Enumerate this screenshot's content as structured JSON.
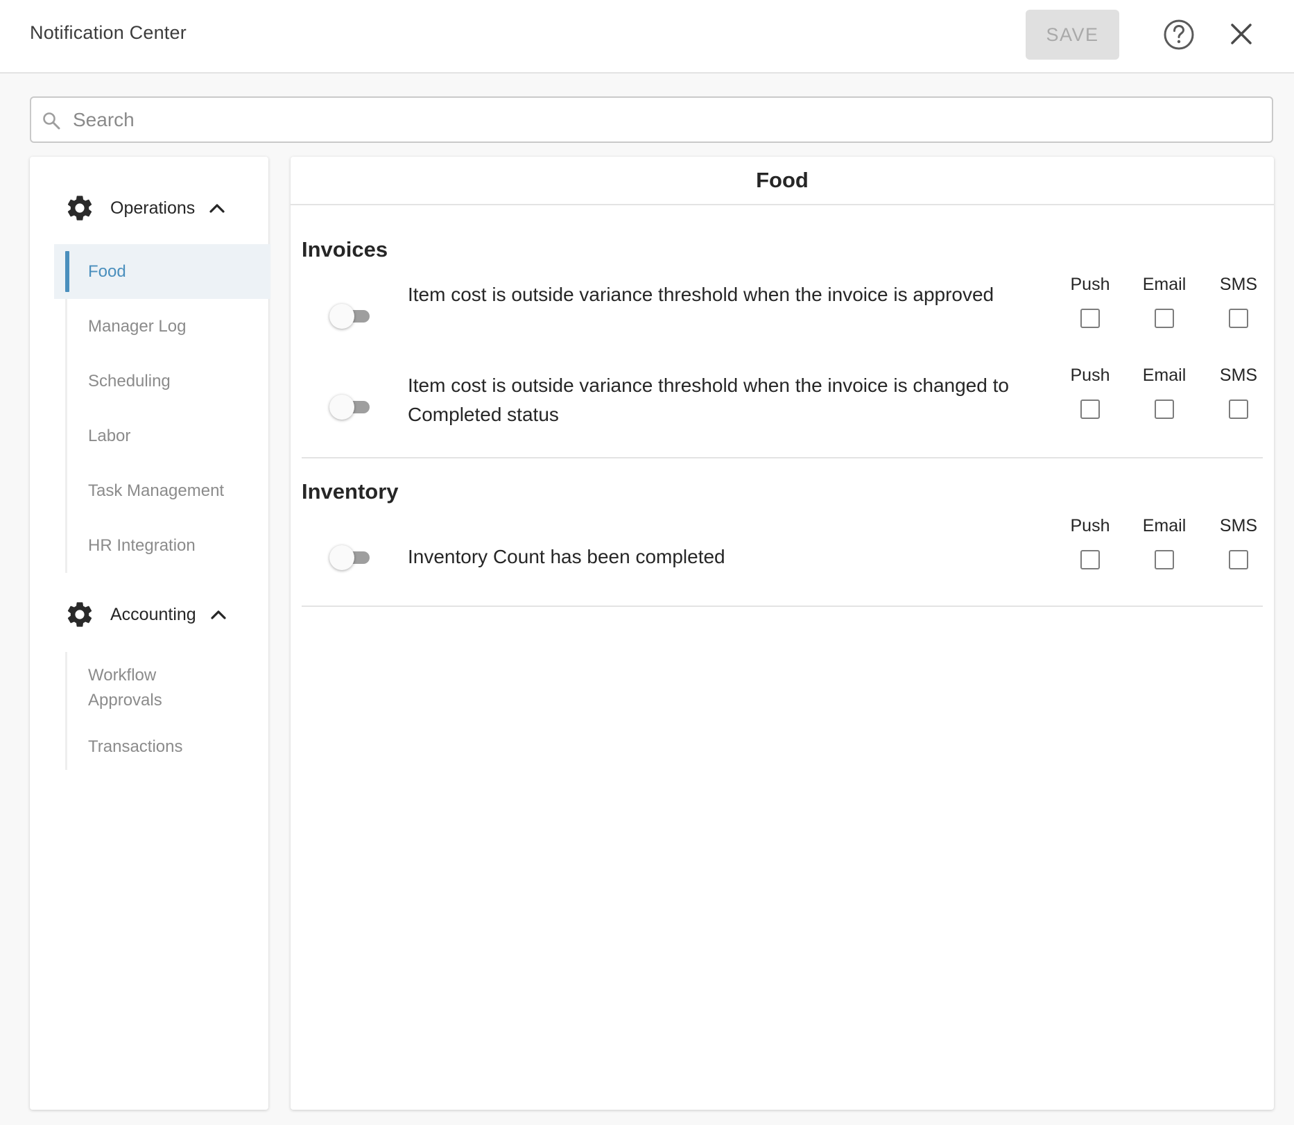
{
  "header": {
    "title": "Notification Center",
    "save_label": "SAVE"
  },
  "search": {
    "placeholder": "Search",
    "value": ""
  },
  "sidebar": {
    "groups": [
      {
        "label": "Operations",
        "icon": "gear-icon",
        "expanded": true,
        "items": [
          {
            "label": "Food",
            "active": true
          },
          {
            "label": "Manager Log",
            "active": false
          },
          {
            "label": "Scheduling",
            "active": false
          },
          {
            "label": "Labor",
            "active": false
          },
          {
            "label": "Task Management",
            "active": false
          },
          {
            "label": "HR Integration",
            "active": false
          }
        ]
      },
      {
        "label": "Accounting",
        "icon": "gear-icon",
        "expanded": true,
        "items": [
          {
            "label": "Workflow Approvals",
            "active": false
          },
          {
            "label": "Transactions",
            "active": false
          }
        ]
      }
    ]
  },
  "main": {
    "title": "Food",
    "sections": [
      {
        "title": "Invoices",
        "rows": [
          {
            "text": "Item cost is outside variance threshold when the invoice is approved",
            "enabled": false,
            "channels": [
              {
                "label": "Push",
                "checked": false
              },
              {
                "label": "Email",
                "checked": false
              },
              {
                "label": "SMS",
                "checked": false
              }
            ]
          },
          {
            "text": "Item cost is outside variance threshold when the invoice is changed to Completed status",
            "enabled": false,
            "channels": [
              {
                "label": "Push",
                "checked": false
              },
              {
                "label": "Email",
                "checked": false
              },
              {
                "label": "SMS",
                "checked": false
              }
            ]
          }
        ]
      },
      {
        "title": "Inventory",
        "rows": [
          {
            "text": "Inventory Count has been completed",
            "enabled": false,
            "channels": [
              {
                "label": "Push",
                "checked": false
              },
              {
                "label": "Email",
                "checked": false
              },
              {
                "label": "SMS",
                "checked": false
              }
            ]
          }
        ]
      }
    ]
  },
  "colors": {
    "accent": "#4a8fbd",
    "active_bg": "#edf2f6",
    "save_disabled_bg": "#e0e0e0",
    "save_disabled_text": "#a9a9a9"
  }
}
